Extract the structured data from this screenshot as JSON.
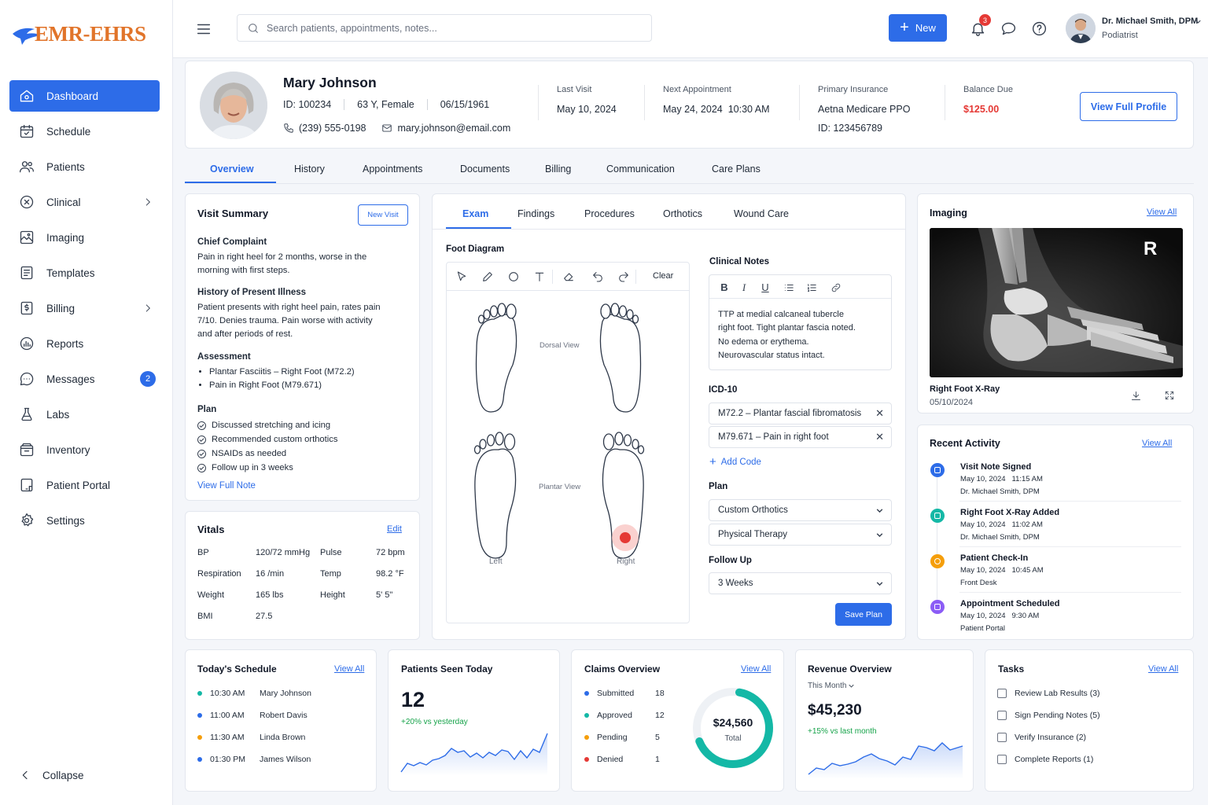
{
  "app": {
    "logo_text": "EMR-EHRS"
  },
  "sidebar": {
    "items": [
      {
        "label": "Dashboard",
        "icon": "home-icon"
      },
      {
        "label": "Schedule",
        "icon": "calendar-icon"
      },
      {
        "label": "Patients",
        "icon": "users-icon"
      },
      {
        "label": "Clinical",
        "icon": "clinical-icon"
      },
      {
        "label": "Imaging",
        "icon": "image-icon"
      },
      {
        "label": "Templates",
        "icon": "template-icon"
      },
      {
        "label": "Billing",
        "icon": "dollar-icon"
      },
      {
        "label": "Reports",
        "icon": "chart-icon"
      },
      {
        "label": "Messages",
        "icon": "message-icon",
        "badge": "2"
      },
      {
        "label": "Labs",
        "icon": "flask-icon"
      },
      {
        "label": "Inventory",
        "icon": "box-icon"
      },
      {
        "label": "Patient Portal",
        "icon": "tablet-icon"
      },
      {
        "label": "Settings",
        "icon": "gear-icon"
      }
    ],
    "collapse_label": "Collapse"
  },
  "topbar": {
    "search_placeholder": "Search patients, appointments, notes...",
    "new_label": "New",
    "notif_count": "3",
    "user_name": "Dr. Michael Smith, DPM",
    "user_role": "Podiatrist"
  },
  "patient": {
    "name": "Mary Johnson",
    "id": "ID: 100234",
    "age_sex": "63 Y, Female",
    "dob": "06/15/1961",
    "phone": "(239) 555-0198",
    "email": "mary.johnson@email.com",
    "last_visit_label": "Last Visit",
    "last_visit": "May 10, 2024",
    "next_appt_label": "Next Appointment",
    "next_appt": "May 24, 2024  10:30 AM",
    "insurance_label": "Primary Insurance",
    "insurance": "Aetna Medicare PPO",
    "insurance_id": "ID: 123456789",
    "balance_label": "Balance Due",
    "balance": "$125.00",
    "profile_btn": "View Full Profile"
  },
  "main_tabs": [
    "Overview",
    "History",
    "Appointments",
    "Documents",
    "Billing",
    "Communication",
    "Care Plans"
  ],
  "visit_summary": {
    "title": "Visit Summary",
    "new_visit": "New Visit",
    "complaint_title": "Chief Complaint",
    "complaint": "Pain in right heel for 2 months, worse in the morning with first steps.",
    "hpi_title": "History of Present Illness",
    "hpi": "Patient presents with right heel pain, rates pain 7/10. Denies trauma. Pain worse with activity and after periods of rest.",
    "assessment_title": "Assessment",
    "assessment": [
      "Plantar Fasciitis – Right Foot (M72.2)",
      "Pain in Right Foot (M79.671)"
    ],
    "plan_title": "Plan",
    "plan": [
      "Discussed stretching and icing",
      "Recommended custom orthotics",
      "NSAIDs as needed",
      "Follow up in 3 weeks"
    ],
    "full_note": "View Full Note"
  },
  "vitals": {
    "title": "Vitals",
    "edit": "Edit",
    "rows": [
      {
        "k1": "BP",
        "v1": "120/72 mmHg",
        "k2": "Pulse",
        "v2": "72 bpm"
      },
      {
        "k1": "Respiration",
        "v1": "16 /min",
        "k2": "Temp",
        "v2": "98.2 °F"
      },
      {
        "k1": "Weight",
        "v1": "165 lbs",
        "k2": "Height",
        "v2": "5' 5\""
      },
      {
        "k1": "BMI",
        "v1": "27.5",
        "k2": "",
        "v2": ""
      }
    ]
  },
  "exam": {
    "tabs": [
      "Exam",
      "Findings",
      "Procedures",
      "Orthotics",
      "Wound Care"
    ],
    "diagram_title": "Foot Diagram",
    "clear": "Clear",
    "dorsal": "Dorsal View",
    "plantar": "Plantar View",
    "left": "Left",
    "right": "Right",
    "notes_title": "Clinical Notes",
    "notes": "TTP at medial calcaneal tubercle right foot. Tight plantar fascia noted. No edema or erythema. Neurovascular status intact.",
    "icd_title": "ICD-10",
    "icd": [
      "M72.2 – Plantar fascial fibromatosis",
      "M79.671 – Pain in right foot"
    ],
    "add_code": "Add Code",
    "plan_title": "Plan",
    "plan_opts": [
      "Custom Orthotics",
      "Physical Therapy"
    ],
    "follow_title": "Follow Up",
    "follow": "3 Weeks",
    "save": "Save Plan"
  },
  "imaging": {
    "title": "Imaging",
    "view_all": "View All",
    "marker": "R",
    "caption": "Right Foot X-Ray",
    "date": "05/10/2024"
  },
  "activity": {
    "title": "Recent Activity",
    "view_all": "View All",
    "items": [
      {
        "title": "Visit Note Signed",
        "time": "May 10, 2024   11:15 AM",
        "by": "Dr. Michael Smith, DPM",
        "color": "#2d6ce8"
      },
      {
        "title": "Right Foot X-Ray Added",
        "time": "May 10, 2024   11:02 AM",
        "by": "Dr. Michael Smith, DPM",
        "color": "#14b8a6"
      },
      {
        "title": "Patient Check-In",
        "time": "May 10, 2024   10:45 AM",
        "by": "Front Desk",
        "color": "#f59e0b"
      },
      {
        "title": "Appointment Scheduled",
        "time": "May 10, 2024   9:30 AM",
        "by": "Patient Portal",
        "color": "#8b5cf6"
      }
    ]
  },
  "schedule": {
    "title": "Today's Schedule",
    "view_all": "View All",
    "rows": [
      {
        "time": "10:30 AM",
        "name": "Mary Johnson",
        "color": "#14b8a6"
      },
      {
        "time": "11:00 AM",
        "name": "Robert Davis",
        "color": "#2d6ce8"
      },
      {
        "time": "11:30 AM",
        "name": "Linda Brown",
        "color": "#f59e0b"
      },
      {
        "time": "01:30 PM",
        "name": "James Wilson",
        "color": "#2d6ce8"
      }
    ]
  },
  "seen": {
    "title": "Patients Seen Today",
    "count": "12",
    "delta": "+20% vs yesterday"
  },
  "claims": {
    "title": "Claims Overview",
    "view_all": "View All",
    "rows": [
      {
        "label": "Submitted",
        "value": "18",
        "color": "#2d6ce8"
      },
      {
        "label": "Approved",
        "value": "12",
        "color": "#14b8a6"
      },
      {
        "label": "Pending",
        "value": "5",
        "color": "#f59e0b"
      },
      {
        "label": "Denied",
        "value": "1",
        "color": "#e53935"
      }
    ],
    "total": "$24,560",
    "total_label": "Total"
  },
  "revenue": {
    "title": "Revenue Overview",
    "period": "This Month",
    "amount": "$45,230",
    "delta": "+15% vs last month"
  },
  "tasks": {
    "title": "Tasks",
    "view_all": "View All",
    "items": [
      "Review Lab Results (3)",
      "Sign Pending Notes (5)",
      "Verify Insurance (2)",
      "Complete Reports (1)"
    ]
  },
  "colors": {
    "accent": "#2d6ce8",
    "danger": "#e53935",
    "success": "#16a34a",
    "teal": "#14b8a6",
    "logo": "#e1742a"
  }
}
